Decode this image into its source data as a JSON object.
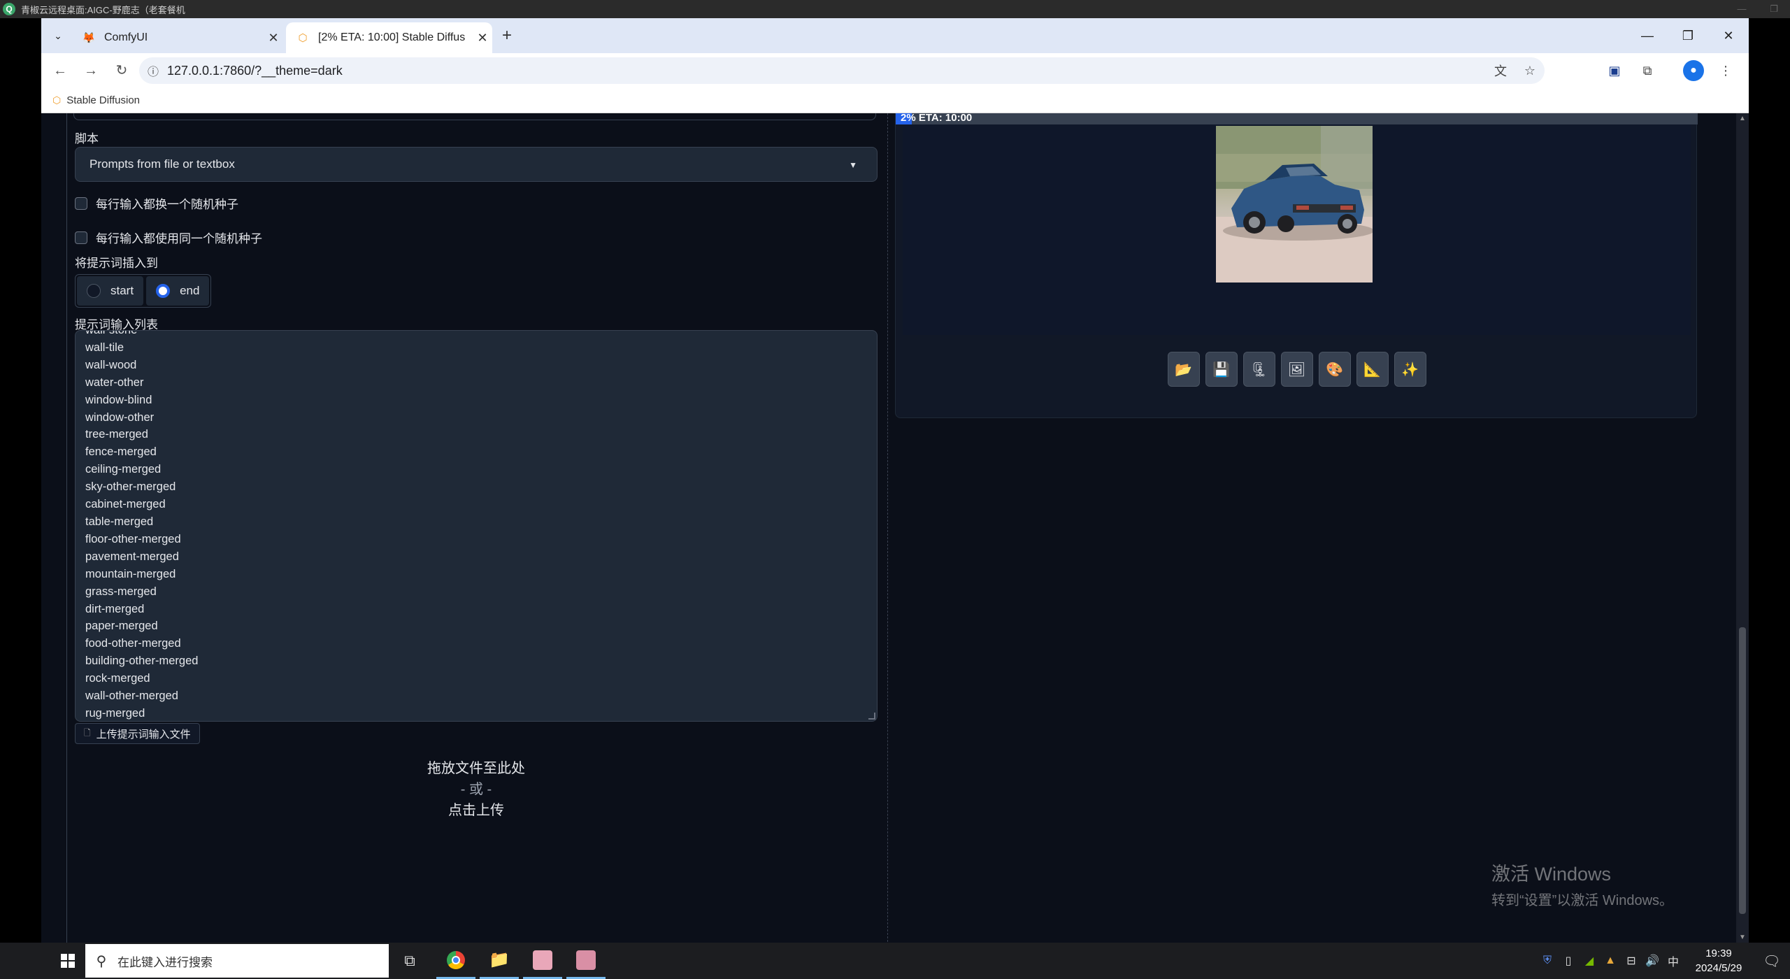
{
  "remote_desktop": {
    "title": "青椒云远程桌面:AIGC-野鹿志（老套餐机"
  },
  "browser": {
    "tabs": [
      {
        "title": "ComfyUI",
        "active": false
      },
      {
        "title": "[2% ETA: 10:00] Stable Diffus",
        "active": true
      }
    ],
    "url": "127.0.0.1:7860/?__theme=dark",
    "bookmark": "Stable Diffusion"
  },
  "script_section": {
    "label": "脚本",
    "selected": "Prompts from file or textbox",
    "checkbox_1": "每行输入都换一个随机种子",
    "checkbox_2": "每行输入都使用同一个随机种子",
    "insert_label": "将提示词插入到",
    "radio_start": "start",
    "radio_end": "end",
    "radio_selected": "end",
    "prompt_list_label": "提示词输入列表",
    "prompt_lines": [
      "wall-stone",
      "wall-tile",
      "wall-wood",
      "water-other",
      "window-blind",
      "window-other",
      "tree-merged",
      "fence-merged",
      "ceiling-merged",
      "sky-other-merged",
      "cabinet-merged",
      "table-merged",
      "floor-other-merged",
      "pavement-merged",
      "mountain-merged",
      "grass-merged",
      "dirt-merged",
      "paper-merged",
      "food-other-merged",
      "building-other-merged",
      "rock-merged",
      "wall-other-merged",
      "rug-merged"
    ],
    "upload_button": "上传提示词输入文件",
    "dropzone": {
      "drop_text": "拖放文件至此处",
      "or_text": "- 或 -",
      "click_text": "点击上传"
    }
  },
  "output_panel": {
    "progress_text": "2% ETA: 10:00",
    "progress_fraction": 0.02,
    "action_buttons": [
      {
        "icon": "folder-icon",
        "glyph": "📂"
      },
      {
        "icon": "save-icon",
        "glyph": "💾"
      },
      {
        "icon": "zip-icon",
        "glyph": "🗜"
      },
      {
        "icon": "send-to-img2img-icon",
        "glyph": "🖼"
      },
      {
        "icon": "send-to-inpaint-icon",
        "glyph": "🎨"
      },
      {
        "icon": "send-to-extras-icon",
        "glyph": "📐"
      },
      {
        "icon": "sparkle-icon",
        "glyph": "✨"
      }
    ]
  },
  "watermark": {
    "line1": "激活 Windows",
    "line2": "转到“设置”以激活 Windows。"
  },
  "taskbar": {
    "search_placeholder": "在此键入进行搜索",
    "ime": "中",
    "time": "19:39",
    "date": "2024/5/29"
  },
  "colors": {
    "page_bg": "#0b0f19",
    "panel_bg": "#1f2937",
    "accent": "#2563eb"
  }
}
